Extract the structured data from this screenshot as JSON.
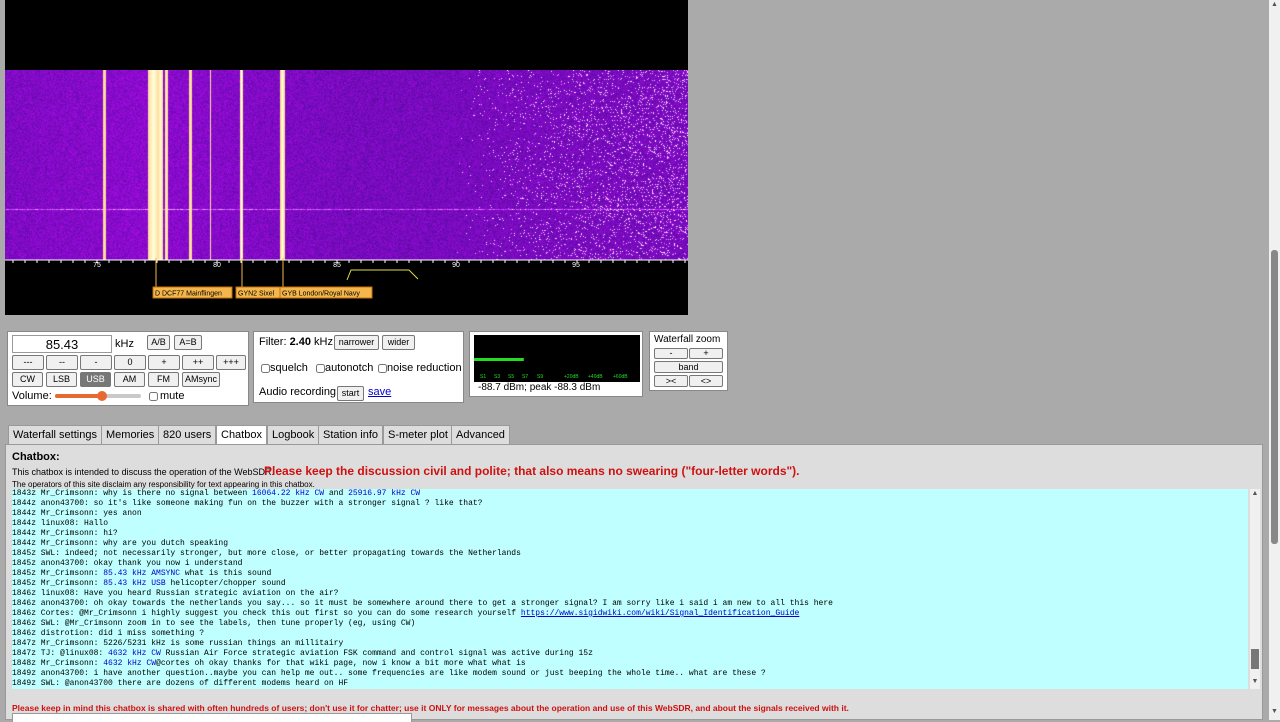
{
  "waterfall": {
    "scale_labels": [
      "75",
      "80",
      "85",
      "90",
      "95"
    ],
    "stations": [
      {
        "label": "D DCF77 Mainflingen"
      },
      {
        "label": "GYN2 Sixel"
      },
      {
        "label": "GYB London/Royal Navy"
      }
    ],
    "colors": {
      "background": "#000000",
      "noise": "#6a1fd0",
      "signal": "#fff4b0",
      "station_bg": "#f4b64b",
      "passband": "#e0e040"
    }
  },
  "tuning": {
    "frequency": "85.43",
    "unit": "kHz",
    "ab_label": "A/B",
    "aeqb_label": "A=B",
    "step_buttons": [
      "---",
      "--",
      "-",
      "0",
      "+",
      "++",
      "+++"
    ],
    "mode_buttons": [
      "CW",
      "LSB",
      "USB",
      "AM",
      "FM",
      "AMsync"
    ],
    "active_mode": "USB",
    "volume_label": "Volume:",
    "volume_level": 0.55,
    "mute_label": "mute"
  },
  "filter": {
    "label": "Filter:",
    "value": "2.40",
    "unit": "kHz",
    "narrower": "narrower",
    "wider": "wider",
    "squelch": "squelch",
    "autonotch": "autonotch",
    "noise_reduction": "noise reduction",
    "audio_recording": "Audio recording",
    "start": "start",
    "save": "save"
  },
  "smeter": {
    "scale": [
      "S1",
      "S3",
      "S5",
      "S7",
      "S9",
      "+20dB",
      "+40dB",
      "+60dB"
    ],
    "level": 0.3,
    "readout": "-88.7 dBm; peak  -88.3 dBm"
  },
  "zoom": {
    "title": "Waterfall zoom",
    "minus": "-",
    "plus": "+",
    "band": "band",
    "shrink": "><",
    "expand": "<>"
  },
  "tabs": [
    "Waterfall settings",
    "Memories",
    "820 users",
    "Chatbox",
    "Logbook",
    "Station info",
    "S-meter plot",
    "Advanced"
  ],
  "active_tab": "Chatbox",
  "chat": {
    "title": "Chatbox:",
    "intro": "This chatbox is intended to discuss the operation of the WebSDR.",
    "warning": "Please keep the discussion civil and polite; that also means no swearing (\"four-letter words\").",
    "disclaimer": "The operators of this site disclaim any responsibility for text appearing in this chatbox.",
    "lines": [
      [
        {
          "t": "1843z Mr_Crimsonn: why is there no signal between "
        },
        {
          "t": "16064.22 kHz CW",
          "c": "lbl"
        },
        {
          "t": " and "
        },
        {
          "t": "25916.97 kHz CW",
          "c": "lbl"
        }
      ],
      [
        {
          "t": "1844z anon43700: so it's like someone making fun on the buzzer with a stronger signal ? like that?"
        }
      ],
      [
        {
          "t": "1844z Mr_Crimsonn: yes anon"
        }
      ],
      [
        {
          "t": "1844z linux08: Hallo"
        }
      ],
      [
        {
          "t": "1844z Mr_Crimsonn: hi?"
        }
      ],
      [
        {
          "t": "1844z Mr_Crimsonn: why are you dutch speaking"
        }
      ],
      [
        {
          "t": "1845z SWL: indeed; not necessarily stronger, but more close, or better propagating towards the Netherlands"
        }
      ],
      [
        {
          "t": "1845z anon43700: okay thank you now i understand"
        }
      ],
      [
        {
          "t": "1845z Mr_Crimsonn: "
        },
        {
          "t": "85.43 kHz AMSYNC",
          "c": "lbl"
        },
        {
          "t": " what is this sound"
        }
      ],
      [
        {
          "t": "1845z Mr_Crimsonn: "
        },
        {
          "t": "85.43 kHz USB",
          "c": "lbl"
        },
        {
          "t": " helicopter/chopper sound"
        }
      ],
      [
        {
          "t": "1846z linux08: Have you heard Russian strategic aviation on the air?"
        }
      ],
      [
        {
          "t": "1846z anon43700: oh okay towards the netherlands you say... so it must be somewhere around there to get a stronger signal? I am sorry like i said i am new to all this here"
        }
      ],
      [
        {
          "t": "1846z Cortes: @Mr_Crimsonn i highly suggest you check this out first so you can do some research yourself "
        },
        {
          "t": "https://www.sigidwiki.com/wiki/Signal_Identification_Guide",
          "c": "lnk"
        }
      ],
      [
        {
          "t": "1846z SWL: @Mr_Crimsonn zoom in to see the labels, then tune properly (eg, using CW)"
        }
      ],
      [
        {
          "t": "1846z distrotion: did i miss something ?"
        }
      ],
      [
        {
          "t": "1847z Mr_Crimsonn: 5226/5231 kHz is some russian things an millitairy"
        }
      ],
      [
        {
          "t": "1847z TJ: @linux08: "
        },
        {
          "t": "4632 kHz CW",
          "c": "lbl"
        },
        {
          "t": " Russian Air Force strategic aviation FSK command and control signal was active during 15z"
        }
      ],
      [
        {
          "t": "1848z Mr_Crimsonn: "
        },
        {
          "t": "4632 kHz CW",
          "c": "lbl"
        },
        {
          "t": "@cortes oh okay thanks for that wiki page, now i know a bit more what what is"
        }
      ],
      [
        {
          "t": "1849z anon43700: i have another question..maybe you can help me out.. some frequencies are like modem sound or just beeping the whole time.. what are these ?"
        }
      ],
      [
        {
          "t": "1849z SWL: @anon43700 there are dozens of different modems heard on HF"
        }
      ]
    ],
    "footer": "Please keep in mind this chatbox is shared with often hundreds of users; don't use it for chatter; use it ONLY for messages about the operation and use of this WebSDR, and about the signals received with it."
  }
}
